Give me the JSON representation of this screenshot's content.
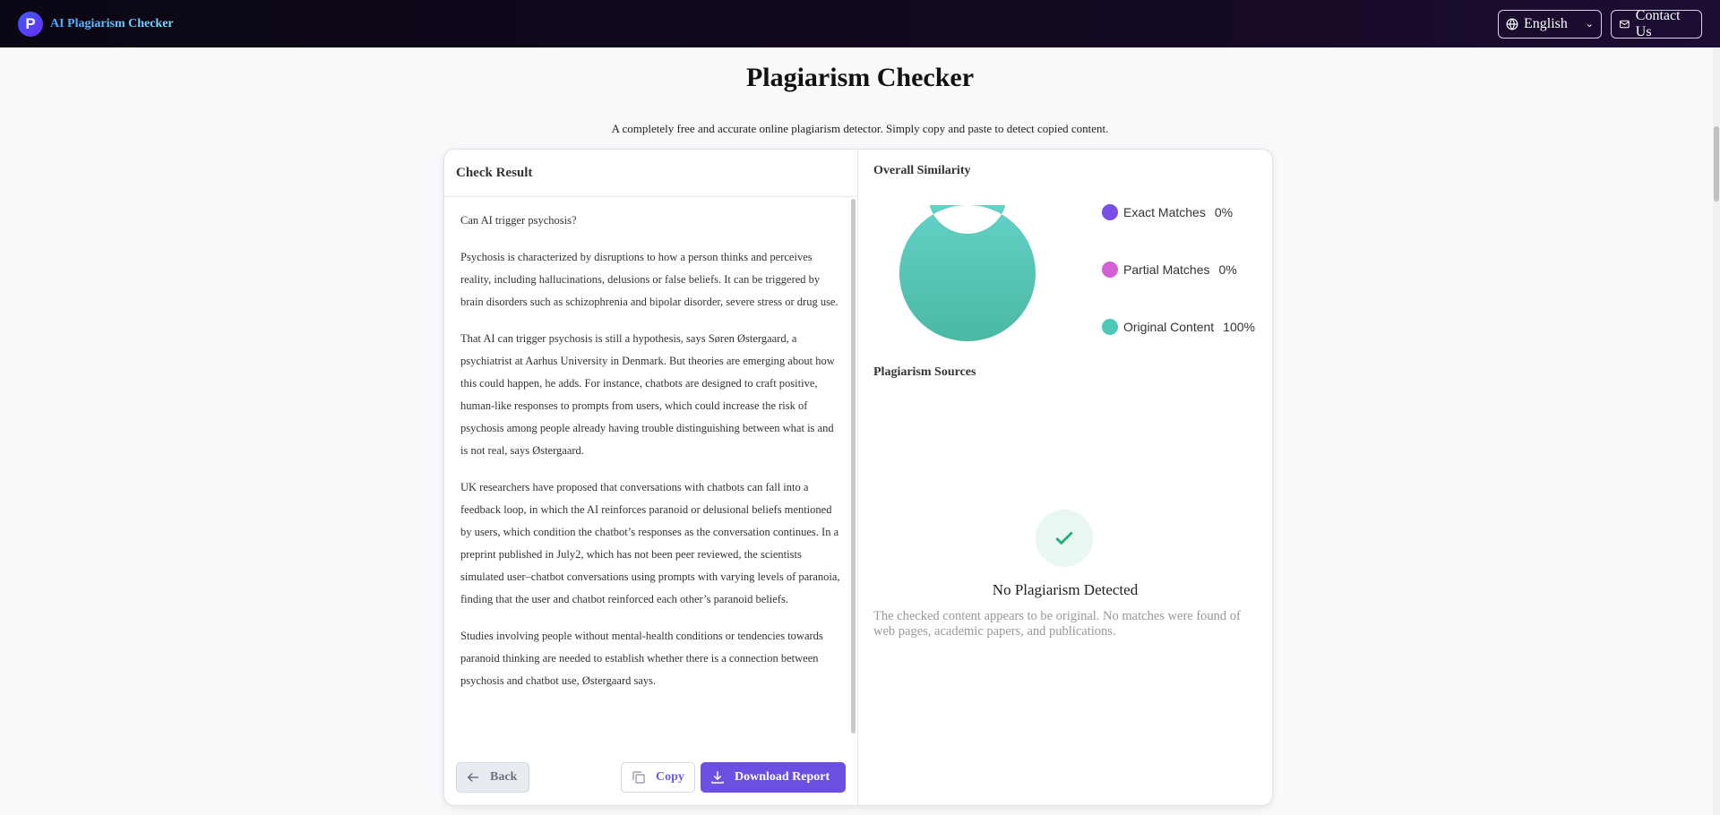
{
  "header": {
    "logo_letter": "P",
    "brand": "AI Plagiarism Checker",
    "language": "English",
    "contact": "Contact Us"
  },
  "page": {
    "title": "Plagiarism Checker",
    "subtitle": "A completely free and accurate online plagiarism detector. Simply copy and paste to detect copied content."
  },
  "left": {
    "header": "Check Result",
    "paragraphs": [
      "Can AI trigger psychosis?",
      "Psychosis is characterized by disruptions to how a person thinks and perceives reality, including hallucinations, delusions or false beliefs. It can be triggered by brain disorders such as schizophrenia and bipolar disorder, severe stress or drug use.",
      "That AI can trigger psychosis is still a hypothesis, says Søren Østergaard, a psychiatrist at Aarhus University in Denmark. But theories are emerging about how this could happen, he adds. For instance, chatbots are designed to craft positive, human-like responses to prompts from users, which could increase the risk of psychosis among people already having trouble distinguishing between what is and is not real, says Østergaard.",
      "UK researchers have proposed that conversations with chatbots can fall into a feedback loop, in which the AI reinforces paranoid or delusional beliefs mentioned by users, which condition the chatbot’s responses as the conversation continues. In a preprint published in July2, which has not been peer reviewed, the scientists simulated user–chatbot conversations using prompts with varying levels of paranoia, finding that the user and chatbot reinforced each other’s paranoid beliefs.",
      "Studies involving people without mental-health conditions or tendencies towards paranoid thinking are needed to establish whether there is a connection between psychosis and chatbot use, Østergaard says."
    ],
    "back": "Back",
    "copy": "Copy",
    "download": "Download Report"
  },
  "right": {
    "similarity_title": "Overall Similarity",
    "legend": [
      {
        "label": "Exact Matches",
        "pct": "0%",
        "color": "#7b4ee8"
      },
      {
        "label": "Partial Matches",
        "pct": "0%",
        "color": "#d45fd6"
      },
      {
        "label": "Original Content",
        "pct": "100%",
        "color": "#4ec9b8"
      }
    ],
    "sources_title": "Plagiarism Sources",
    "no_plag_title": "No Plagiarism Detected",
    "no_plag_desc": "The checked content appears to be original. No matches were found of web pages, academic papers, and publications."
  },
  "chart_data": {
    "type": "pie",
    "categories": [
      "Exact Matches",
      "Partial Matches",
      "Original Content"
    ],
    "values": [
      0,
      0,
      100
    ]
  }
}
